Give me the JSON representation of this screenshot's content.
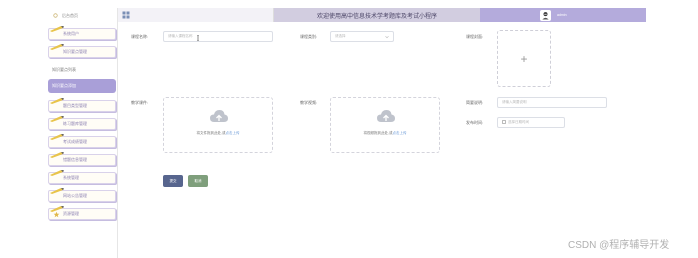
{
  "header": {
    "title": "欢迎使用高中信息技术学考题库及考试小程序",
    "username": "admin"
  },
  "sidebar": {
    "items": [
      {
        "label": "后台首页",
        "style": "plain"
      },
      {
        "label": "系统用户",
        "style": "framed"
      },
      {
        "label": "知识要点管理",
        "style": "framed"
      },
      {
        "label": "知识要点列表",
        "style": "sub"
      },
      {
        "label": "知识要点添加",
        "style": "active"
      },
      {
        "label": "题目类型管理",
        "style": "framed"
      },
      {
        "label": "练习题库管理",
        "style": "framed"
      },
      {
        "label": "考试成绩管理",
        "style": "framed"
      },
      {
        "label": "错题信息管理",
        "style": "framed"
      },
      {
        "label": "系统管理",
        "style": "framed"
      },
      {
        "label": "网站公告管理",
        "style": "framed"
      },
      {
        "label": "资源管理",
        "style": "framed"
      }
    ]
  },
  "form": {
    "course_name_label": "课程名称:",
    "course_name_placeholder": "请输入课程名称",
    "course_type_label": "课程类别:",
    "course_type_value": "请选择",
    "course_cover_label": "课程封面:",
    "cover_plus": "+",
    "courseware_label": "教学课件:",
    "courseware_hint": "将文件拖到此处,或",
    "courseware_link": "点击上传",
    "video_label": "教学视频:",
    "video_hint": "将视频拖到此处,或",
    "video_link": "点击上传",
    "desc_label": "简要说明:",
    "desc_placeholder": "请输入简要说明",
    "time_label": "发布时间:",
    "time_placeholder": "选择日期时间"
  },
  "buttons": {
    "submit": "提交",
    "cancel": "取消"
  },
  "watermark": "CSDN @程序辅导开发",
  "colors": {
    "accent": "#a99fd8",
    "header_mid": "#d2cde0",
    "header_right": "#b4abdc",
    "submit": "#57658e",
    "cancel": "#7f9f7c"
  }
}
